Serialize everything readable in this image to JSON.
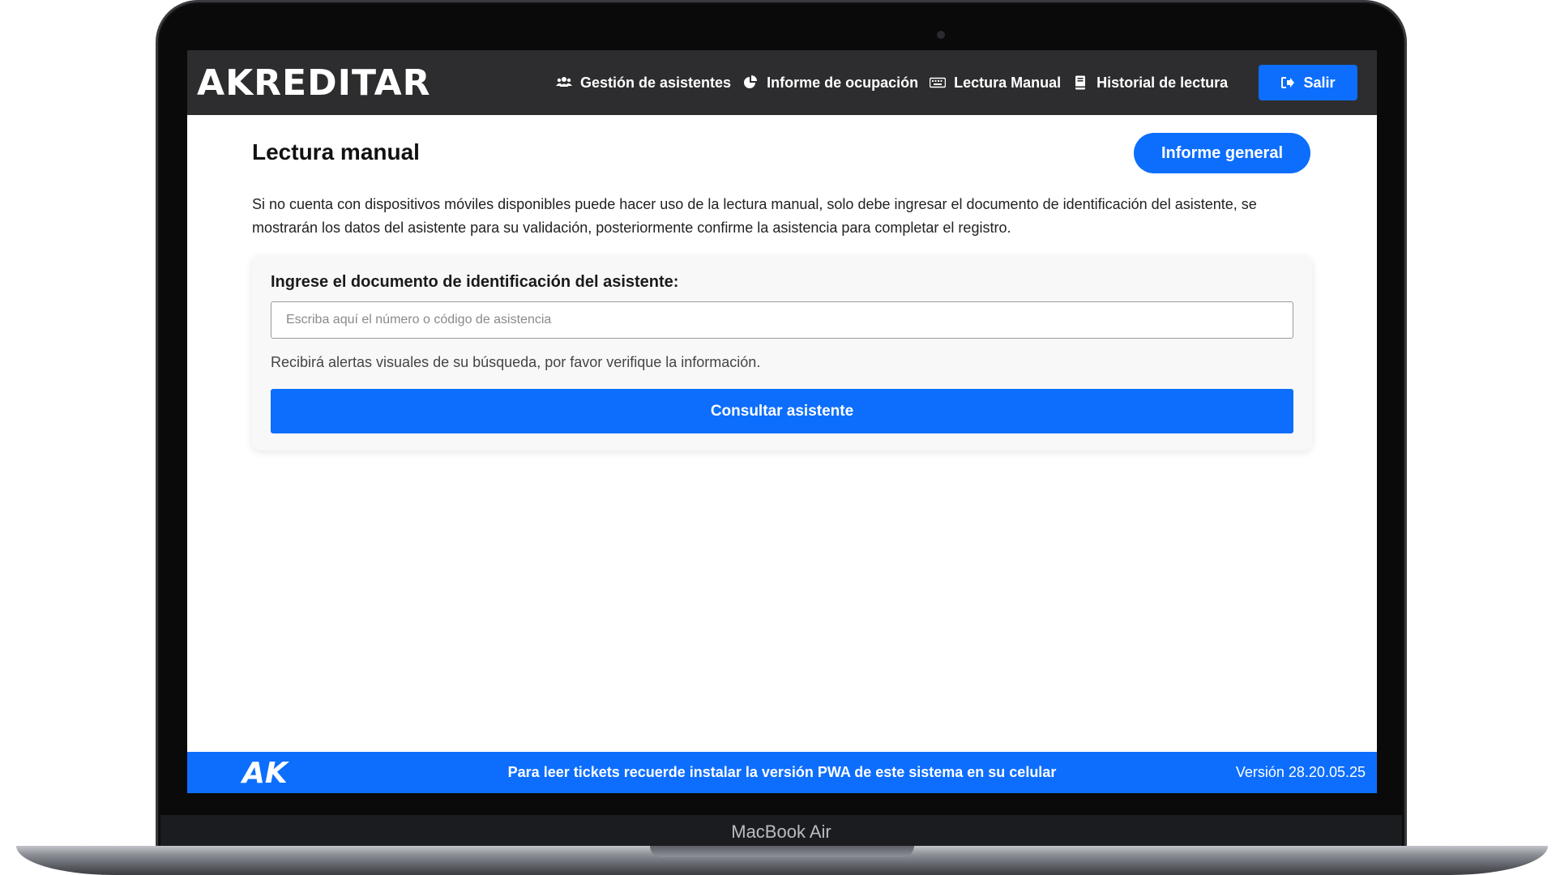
{
  "device": {
    "model_label": "MacBook Air"
  },
  "header": {
    "logo_text_a": "A",
    "logo_text_k": "K",
    "logo_text_rest": "REDITAR",
    "nav": [
      {
        "label": "Gestión de asistentes",
        "icon": "users-icon"
      },
      {
        "label": "Informe de ocupación",
        "icon": "pie-chart-icon"
      },
      {
        "label": "Lectura Manual",
        "icon": "keyboard-icon"
      },
      {
        "label": "Historial de lectura",
        "icon": "book-icon"
      }
    ],
    "logout_label": "Salir",
    "logout_icon": "sign-out-icon"
  },
  "main": {
    "title": "Lectura manual",
    "report_button": "Informe general",
    "description": "Si no cuenta con dispositivos móviles disponibles puede hacer uso de la lectura manual, solo debe ingresar el documento de identificación del asistente, se mostrarán los datos del asistente para su validación, posteriormente confirme la asistencia para completar el registro.",
    "card": {
      "label": "Ingrese el documento de identificación del asistente:",
      "input_value": "",
      "input_placeholder": "Escriba aquí el número o código de asistencia",
      "hint": "Recibirá alertas visuales de su búsqueda, por favor verifique la información.",
      "submit_label": "Consultar asistente"
    }
  },
  "footer": {
    "logo_text": "AK",
    "message": "Para leer tickets recuerde instalar la versión PWA de este sistema en su celular",
    "version": "Versión 28.20.05.25"
  },
  "colors": {
    "primary": "#0d6efd",
    "navbar_bg": "#2d2d2f",
    "card_bg": "#f8f8f9"
  }
}
